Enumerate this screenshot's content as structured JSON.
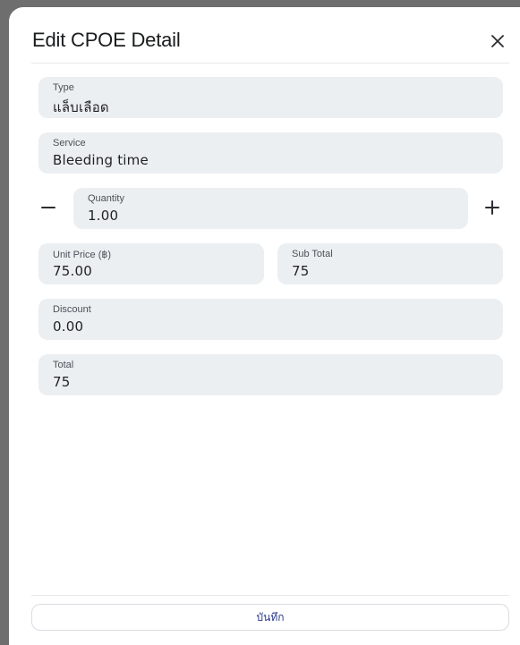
{
  "dialog": {
    "title": "Edit CPOE Detail",
    "close_icon": "close-icon"
  },
  "fields": {
    "type": {
      "label": "Type",
      "value": "แล็บเลือด"
    },
    "service": {
      "label": "Service",
      "value": "Bleeding time"
    },
    "quantity": {
      "label": "Quantity",
      "value": "1.00",
      "decrement_icon": "minus-icon",
      "increment_icon": "plus-icon"
    },
    "unit_price": {
      "label": "Unit Price (฿)",
      "value": "75.00"
    },
    "sub_total": {
      "label": "Sub Total",
      "value": "75"
    },
    "discount": {
      "label": "Discount",
      "value": "0.00"
    },
    "total": {
      "label": "Total",
      "value": "75"
    }
  },
  "footer": {
    "save_label": "บันทึก"
  }
}
